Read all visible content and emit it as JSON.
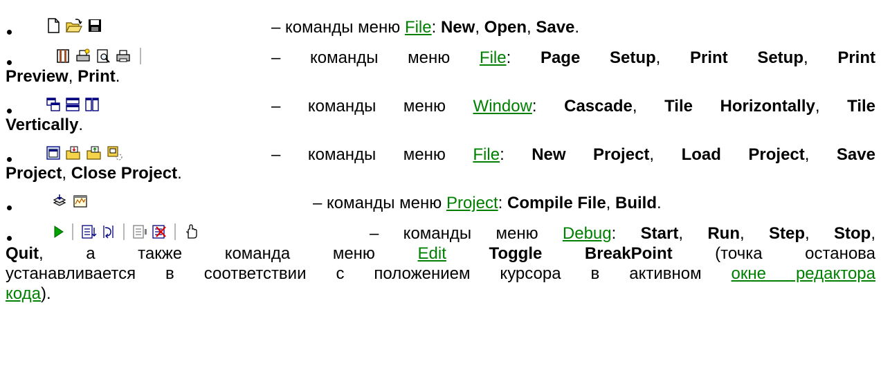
{
  "dash": "– команды меню ",
  "comma": ", ",
  "period": ".",
  "colon": ": ",
  "items": [
    {
      "menu": "File",
      "cmds": [
        "New",
        "Open",
        "Save"
      ],
      "icons": [
        "new-file-icon",
        "open-folder-icon",
        "save-disk-icon"
      ]
    },
    {
      "menu": "File",
      "cmds": [
        "Page Setup",
        "Print Setup",
        "Print",
        "Preview",
        "Print"
      ],
      "icons": [
        "page-setup-icon",
        "print-setup-icon",
        "print-preview-icon",
        "print-icon"
      ]
    },
    {
      "menu": "Window",
      "cmds": [
        "Cascade",
        "Tile Horizontally",
        "Tile",
        "Vertically"
      ],
      "icons": [
        "cascade-icon",
        "tile-horizontally-icon",
        "tile-vertically-icon"
      ]
    },
    {
      "menu": "File",
      "cmds": [
        "New Project",
        "Load Project",
        "Save",
        "Project",
        "Close Project"
      ],
      "icons": [
        "new-project-icon",
        "load-project-icon",
        "save-project-icon",
        "close-project-icon"
      ]
    },
    {
      "menu": "Project",
      "cmds": [
        "Compile File",
        "Build"
      ],
      "icons": [
        "compile-file-icon",
        "build-icon"
      ]
    },
    {
      "menu": "Debug",
      "cmds": [
        "Start",
        "Run",
        "Step",
        "Stop",
        "Quit"
      ],
      "also": ", а также команда меню ",
      "menu2": "Edit",
      "cmd2": "Toggle BreakPoint",
      "note1": " (точка останова",
      "note2": "устанавливается в соответствии с положением курсора в активном ",
      "link": "окне редактора",
      "link2": "кода",
      "tail": ").",
      "icons": [
        "start-icon",
        "run-icon",
        "step-icon",
        "stop-icon",
        "quit-icon",
        "toggle-breakpoint-icon"
      ]
    }
  ]
}
